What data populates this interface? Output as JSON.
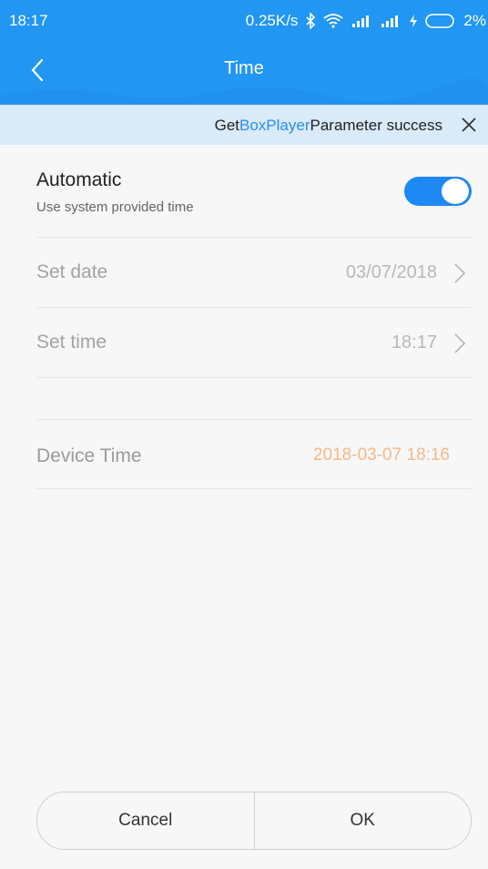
{
  "status_bar": {
    "time": "18:17",
    "net_speed": "0.25K/s",
    "battery": "2%",
    "icons": [
      "bluetooth-icon",
      "wifi-icon",
      "signal-icon",
      "signal-icon",
      "charging-icon",
      "battery-icon"
    ]
  },
  "header": {
    "title": "Time",
    "back_icon": "back-arrow-icon",
    "color": "#2196f3"
  },
  "toast": {
    "prefix": "Get",
    "highlight": "BoxPlayer",
    "suffix": "Parameter success",
    "close_icon": "close-icon"
  },
  "automatic": {
    "title": "Automatic",
    "subtitle": "Use system provided time",
    "enabled": true
  },
  "set_date": {
    "label": "Set date",
    "value": "03/07/2018"
  },
  "set_time": {
    "label": "Set time",
    "value": "18:17"
  },
  "device_time": {
    "label": "Device Time",
    "value": "2018-03-07 18:16"
  },
  "buttons": {
    "cancel": "Cancel",
    "ok": "OK"
  }
}
